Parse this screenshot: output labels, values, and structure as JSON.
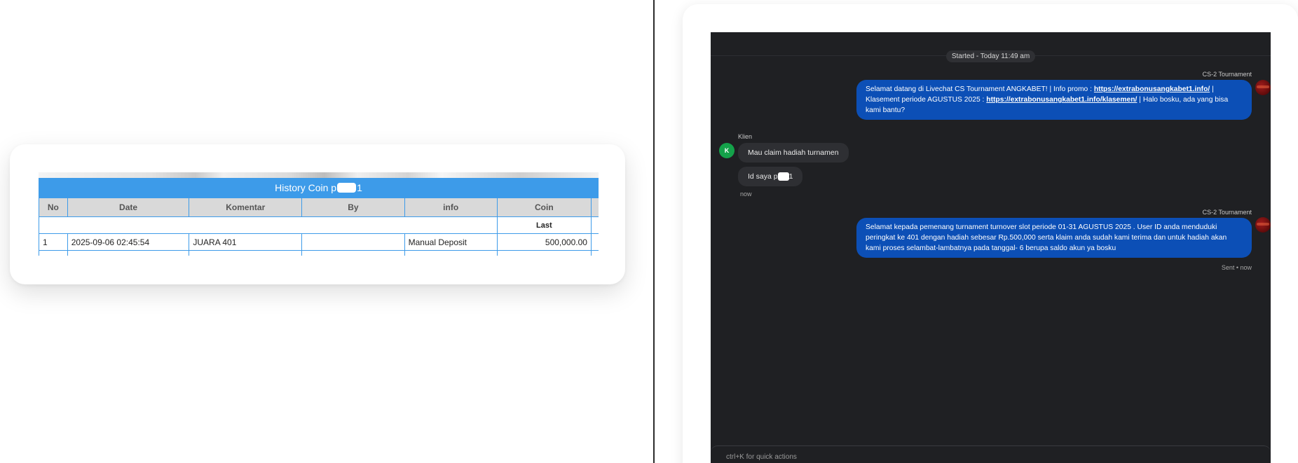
{
  "history": {
    "title_start": "History Coin p",
    "title_end": "1",
    "columns": [
      "No",
      "Date",
      "Komentar",
      "By",
      "info",
      "Coin"
    ],
    "subheader": "Last",
    "rows": [
      {
        "no": "1",
        "date": "2025-09-06 02:45:54",
        "komentar": "JUARA 401",
        "by": "",
        "info": "Manual Deposit",
        "coin": "500,000.00"
      }
    ]
  },
  "chat": {
    "started": "Started - Today 11:49 am",
    "agent_name": "CS-2 Tournament",
    "client_name": "Klien",
    "client_initial": "K",
    "msg1": {
      "p1": "Selamat datang di Livechat CS Tournament ANGKABET! | Info promo : ",
      "link1": "https://extrabonusangkabet1.info/",
      "p2": " | Klasement periode AGUSTUS 2025 : ",
      "link2": "https://extrabonusangkabet1.info/klasemen/",
      "p3": " | Halo bosku, ada yang bisa kami bantu?"
    },
    "client_msg1": "Mau claim hadiah turnamen",
    "client_msg2_start": "Id saya p",
    "client_msg2_end": "1",
    "client_time": "now",
    "msg2": "Selamat kepada pemenang turnament turnover slot periode 01-31 AGUSTUS 2025 . User ID anda menduduki peringkat ke 401 dengan hadiah sebesar Rp.500,000 serta klaim anda sudah kami terima dan untuk hadiah akan kami proses selambat-lambatnya pada tanggal- 6 berupa saldo akun ya bosku",
    "sent_status": "Sent • now",
    "composer_hint": "ctrl+K for quick actions"
  },
  "colors": {
    "table_header": "#3d9be9",
    "agent_bubble": "#0c4fb6",
    "chat_bg": "#1f2023",
    "coin_positive": "#1a8a1a"
  }
}
